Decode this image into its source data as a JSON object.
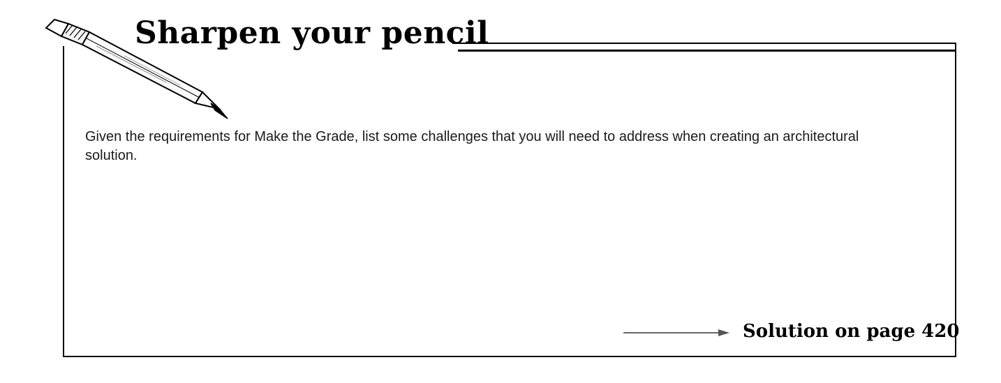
{
  "header": {
    "title": "Sharpen your pencil"
  },
  "exercise": {
    "prompt": "Given the requirements for Make the Grade, list some challenges that you will need to address when creating an architectural solution."
  },
  "footer": {
    "solution_link": "Solution on page 420"
  },
  "icons": {
    "pencil": "pencil-icon",
    "arrow": "arrow-right-icon"
  }
}
